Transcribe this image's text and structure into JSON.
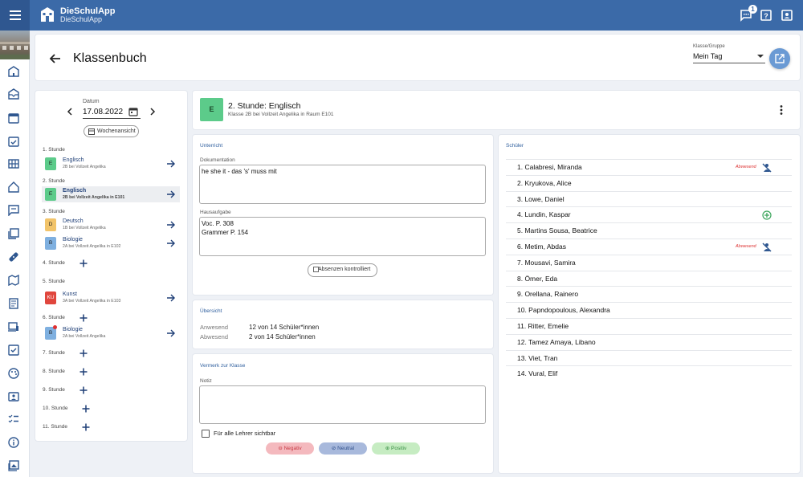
{
  "app": {
    "title": "DieSchulApp",
    "subtitle": "DieSchulApp",
    "notification_count": "1"
  },
  "colors": {
    "primary": "#3b6aa8",
    "link": "#2f5f9e",
    "absent": "#d33333",
    "positive": "#3aa55a"
  },
  "sidebar": {
    "icons": [
      "school-icon",
      "inbox-icon",
      "calendar-icon",
      "calendar-check-icon",
      "grid-icon",
      "home-icon",
      "chat-icon",
      "library-icon",
      "bandage-icon",
      "map-icon",
      "book-icon",
      "devices-icon",
      "task-icon",
      "palette-icon",
      "id-card-icon",
      "checklist-icon",
      "info-icon",
      "gallery-icon"
    ]
  },
  "header": {
    "title": "Klassenbuch",
    "klasse_label": "Klasse/Gruppe",
    "klasse_value": "Mein Tag"
  },
  "date": {
    "label": "Datum",
    "value": "17.08.2022",
    "week_button": "Wochenansicht"
  },
  "stunden": [
    {
      "label": "1. Stunde",
      "lessons": [
        {
          "badge": "E",
          "color": "#5ccb8a",
          "name": "Englisch",
          "sub": "2B bei Vollzeit Angelika",
          "active": false
        }
      ]
    },
    {
      "label": "2. Stunde",
      "lessons": [
        {
          "badge": "E",
          "color": "#5ccb8a",
          "name": "Englisch",
          "sub": "2B bei Vollzeit Angelika in E101",
          "active": true
        }
      ]
    },
    {
      "label": "3. Stunde",
      "lessons": [
        {
          "badge": "D",
          "color": "#f2c46a",
          "name": "Deutsch",
          "sub": "1B bei Vollzeit Angelika",
          "active": false
        },
        {
          "badge": "B",
          "color": "#7fb0e0",
          "name": "Biologie",
          "sub": "2A bei Vollzeit Angelika in E102",
          "active": false
        }
      ]
    },
    {
      "label": "4. Stunde",
      "lessons": []
    },
    {
      "label": "5. Stunde",
      "lessons": [
        {
          "badge": "KU",
          "color": "#e0463d",
          "name": "Kunst",
          "sub": "3A bei Vollzeit Angelika in E103",
          "active": false
        }
      ]
    },
    {
      "label": "6. Stunde",
      "lessons": [
        {
          "badge": "B",
          "color": "#7fb0e0",
          "name": "Biologie",
          "sub": "2A bei Vollzeit Angelika",
          "active": false,
          "dot": true
        }
      ]
    },
    {
      "label": "7. Stunde",
      "lessons": []
    },
    {
      "label": "8. Stunde",
      "lessons": []
    },
    {
      "label": "9. Stunde",
      "lessons": []
    },
    {
      "label": "10. Stunde",
      "lessons": []
    },
    {
      "label": "11. Stunde",
      "lessons": []
    }
  ],
  "lesson": {
    "badge": "E",
    "title": "2. Stunde: Englisch",
    "subtitle": "Klasse 2B bei Vollzeit Angelika in Raum E101"
  },
  "unterricht": {
    "title": "Unterricht",
    "doku_label": "Dokumentation",
    "doku_value": "he she it - das 's' muss mit",
    "hausaufgabe_label": "Hausaufgabe",
    "hausaufgabe_value": "Voc. P. 308\nGrammer P. 154",
    "absenzen_button": "Absenzen kontrolliert"
  },
  "uebersicht": {
    "title": "Übersicht",
    "anwesend_label": "Anwesend",
    "anwesend_value": "12 von 14 Schüler*innen",
    "abwesend_label": "Abwesend",
    "abwesend_value": "2 von 14 Schüler*innen"
  },
  "vermerk": {
    "title": "Vermerk zur Klasse",
    "notiz_label": "Notiz",
    "notiz_value": "",
    "sichtbar_label": "Für alle Lehrer sichtbar",
    "negativ": "Negativ",
    "neutral": "Neutral",
    "positiv": "Positiv"
  },
  "schueler": {
    "title": "Schüler",
    "list": [
      {
        "name": "1. Calabresi, Miranda",
        "status": "Abwesend",
        "icon": "person-cross-icon"
      },
      {
        "name": "2. Kryukova, Alice",
        "status": "",
        "icon": ""
      },
      {
        "name": "3. Lowe, Daniel",
        "status": "",
        "icon": ""
      },
      {
        "name": "4. Lundin, Kaspar",
        "status": "",
        "icon": "add-circle-icon"
      },
      {
        "name": "5. Martins Sousa, Beatrice",
        "status": "",
        "icon": ""
      },
      {
        "name": "6. Metim, Abdas",
        "status": "Abwesend",
        "icon": "person-cross-icon"
      },
      {
        "name": "7. Mousavi, Samira",
        "status": "",
        "icon": ""
      },
      {
        "name": "8. Ömer, Eda",
        "status": "",
        "icon": ""
      },
      {
        "name": "9. Orellana, Rainero",
        "status": "",
        "icon": ""
      },
      {
        "name": "10. Papndopoulous, Alexandra",
        "status": "",
        "icon": ""
      },
      {
        "name": "11. Ritter, Emelie",
        "status": "",
        "icon": ""
      },
      {
        "name": "12. Tamez Amaya, Libano",
        "status": "",
        "icon": ""
      },
      {
        "name": "13. Viet, Tran",
        "status": "",
        "icon": ""
      },
      {
        "name": "14. Vural, Elif",
        "status": "",
        "icon": ""
      }
    ]
  }
}
